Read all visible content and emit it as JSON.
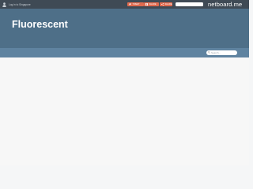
{
  "topbar": {
    "login_text": "Log in to Singapore",
    "share_buttons": [
      {
        "label": "TWEET",
        "icon": "twitter-icon"
      },
      {
        "label": "SHARE",
        "icon": "facebook-icon"
      },
      {
        "label": "SHARE",
        "icon": "share-icon"
      }
    ],
    "tools": [
      "info-icon",
      "dice-icon",
      "eye-icon",
      "expand-icon"
    ],
    "brand": "netboard.me",
    "exit_icon": "sign-in-icon"
  },
  "header": {
    "title": "Fluorescent"
  },
  "subbar": {
    "search_placeholder": "Search..."
  },
  "colors": {
    "topbar": "#3f4a55",
    "header": "#4e6f88",
    "subbar": "#5f83a0",
    "share_button": "#e06a4e",
    "content": "#f7f7f7"
  }
}
